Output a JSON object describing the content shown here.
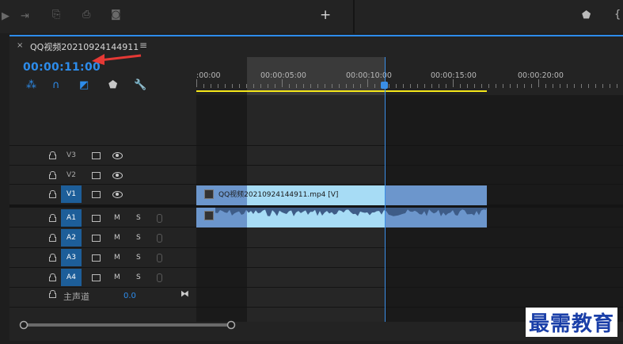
{
  "sequence": {
    "tab_title": "QQ视频20210924144911",
    "timecode": "00:00:11:00"
  },
  "ruler": {
    "labels": [
      ":00:00",
      "00:00:05:00",
      "00:00:10:00",
      "00:00:15:00",
      "00:00:20:00"
    ]
  },
  "tracks": {
    "video": [
      {
        "name": "V3",
        "selected": false
      },
      {
        "name": "V2",
        "selected": false
      },
      {
        "name": "V1",
        "selected": true
      }
    ],
    "audio": [
      {
        "name": "A1",
        "m": "M",
        "s": "S"
      },
      {
        "name": "A2",
        "m": "M",
        "s": "S"
      },
      {
        "name": "A3",
        "m": "M",
        "s": "S"
      },
      {
        "name": "A4",
        "m": "M",
        "s": "S"
      }
    ],
    "master": {
      "label": "主声道",
      "value": "0.0"
    }
  },
  "clips": {
    "video_clip_name": "QQ视频20210924144911.mp4 [V]"
  },
  "watermark": "最需教育",
  "colors": {
    "accent": "#2d8ceb",
    "clip_video": "#6c96cc",
    "clip_selected": "#a7dcf5",
    "annotation": "#e53935",
    "work_area": "#f5e71a"
  }
}
